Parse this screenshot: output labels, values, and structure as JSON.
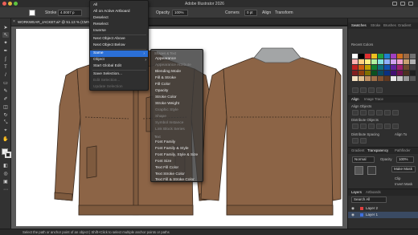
{
  "app": {
    "title": "Adobe Illustrator 2026"
  },
  "controlbar": {
    "selection_label": "Path",
    "stroke_label": "Stroke",
    "stroke_value": "4.0007 p",
    "opacity_label": "Opacity",
    "opacity_value": "100%",
    "corners_label": "Corners",
    "corners_value": "0 pt",
    "align_label": "Align",
    "transform_label": "Transform"
  },
  "document": {
    "tab_label": "WORKWEAR_JACKET.ai* @ 51.13 % (CMYK/P...",
    "close_icon": "×"
  },
  "select_menu": {
    "items": [
      {
        "label": "All",
        "disabled": false
      },
      {
        "label": "All on Active Artboard",
        "disabled": false
      },
      {
        "label": "Deselect",
        "disabled": false
      },
      {
        "label": "Reselect",
        "disabled": false
      },
      {
        "label": "Inverse",
        "disabled": false
      },
      {
        "label": "Next Object Above",
        "disabled": false
      },
      {
        "label": "Next Object Below",
        "disabled": false
      },
      {
        "label": "Same",
        "disabled": false,
        "highlight": true,
        "submenu_arrow": "›"
      },
      {
        "label": "Object",
        "disabled": false,
        "submenu_arrow": "›"
      },
      {
        "label": "Start Global Edit",
        "disabled": false
      },
      {
        "label": "Save Selection...",
        "disabled": false
      },
      {
        "label": "Edit Selection...",
        "disabled": true
      },
      {
        "label": "Update Selection",
        "disabled": true
      }
    ]
  },
  "same_submenu": {
    "group_fill_stroke": "Shapes & Text",
    "group_text": "Text",
    "items_top": [
      {
        "label": "Appearance",
        "disabled": false
      },
      {
        "label": "Appearance Attribute",
        "disabled": true
      },
      {
        "label": "Blending Mode",
        "disabled": false
      },
      {
        "label": "Fill & Stroke",
        "disabled": false
      },
      {
        "label": "Fill Color",
        "disabled": false
      },
      {
        "label": "Opacity",
        "disabled": false
      },
      {
        "label": "Stroke Color",
        "disabled": false
      },
      {
        "label": "Stroke Weight",
        "disabled": false
      },
      {
        "label": "Graphic Style",
        "disabled": true
      },
      {
        "label": "Shape",
        "disabled": true
      },
      {
        "label": "Symbol Instance",
        "disabled": true
      },
      {
        "label": "Link Block Series",
        "disabled": true
      }
    ],
    "items_text": [
      {
        "label": "Font Family",
        "disabled": false
      },
      {
        "label": "Font Family & Style",
        "disabled": false
      },
      {
        "label": "Font Family, Style & Size",
        "disabled": false
      },
      {
        "label": "Font Size",
        "disabled": false
      },
      {
        "label": "Text Fill Color",
        "disabled": false
      },
      {
        "label": "Text Stroke Color",
        "disabled": false
      },
      {
        "label": "Text Fill & Stroke Color",
        "disabled": false
      }
    ]
  },
  "panels": {
    "top_tabs": [
      "Swatches",
      "Stroke",
      "Brushes",
      "Gradient"
    ],
    "recent_colors_label": "Recent Colors",
    "swatch_colors": [
      "#ffffff",
      "#000000",
      "#e03030",
      "#f0c020",
      "#20a040",
      "#2080d0",
      "#a040c0",
      "#d07020",
      "#9c6a45",
      "#707070",
      "#ffb0b0",
      "#ffd080",
      "#fff080",
      "#b0f0a0",
      "#80e0e0",
      "#90b0ff",
      "#d0a0f0",
      "#f0a0d0",
      "#c8a070",
      "#b0b0b0",
      "#c02020",
      "#d06010",
      "#c0a000",
      "#108030",
      "#107080",
      "#1050b0",
      "#6020a0",
      "#a02070",
      "#6e4a30",
      "#404040",
      "#802020",
      "#904010",
      "#807000",
      "#0a5020",
      "#0a4a60",
      "#0a3080",
      "#401070",
      "#701050",
      "#4a3020",
      "#202020",
      "#f4e0c0",
      "#e0c090",
      "#c09060",
      "#a07048",
      "#805030",
      "#603820",
      "#e8e8e8",
      "#c8c8c8",
      "#989898",
      "#585858"
    ],
    "align_tabs": [
      "Align",
      "Image Trace"
    ],
    "align_objects_label": "Align Objects",
    "distribute_objects_label": "Distribute Objects",
    "distribute_spacing_label": "Distribute Spacing",
    "align_to_label": "Align To",
    "transparency_tabs": [
      "Gradient",
      "Transparency",
      "Pathfinder"
    ],
    "blend_mode": "Normal",
    "opacity_label": "Opacity",
    "opacity_value": "100%",
    "make_mask_label": "Make Mask",
    "clip_label": "Clip",
    "invert_mask_label": "Invert Mask",
    "layers_tabs": [
      "Layers",
      "Artboards"
    ],
    "search_placeholder": "Search All",
    "layers": [
      {
        "name": "Layer 2",
        "color": "#e04040"
      },
      {
        "name": "Layer 1",
        "color": "#4070e0"
      }
    ]
  },
  "status": {
    "hint": "Select the path or anchor point of an object  |  Shift+Click to select multiple anchor points or paths",
    "right": "Object Selection"
  },
  "artwork": {
    "jacket_color": "#8c6446",
    "collar_color": "#a3a5a6"
  }
}
